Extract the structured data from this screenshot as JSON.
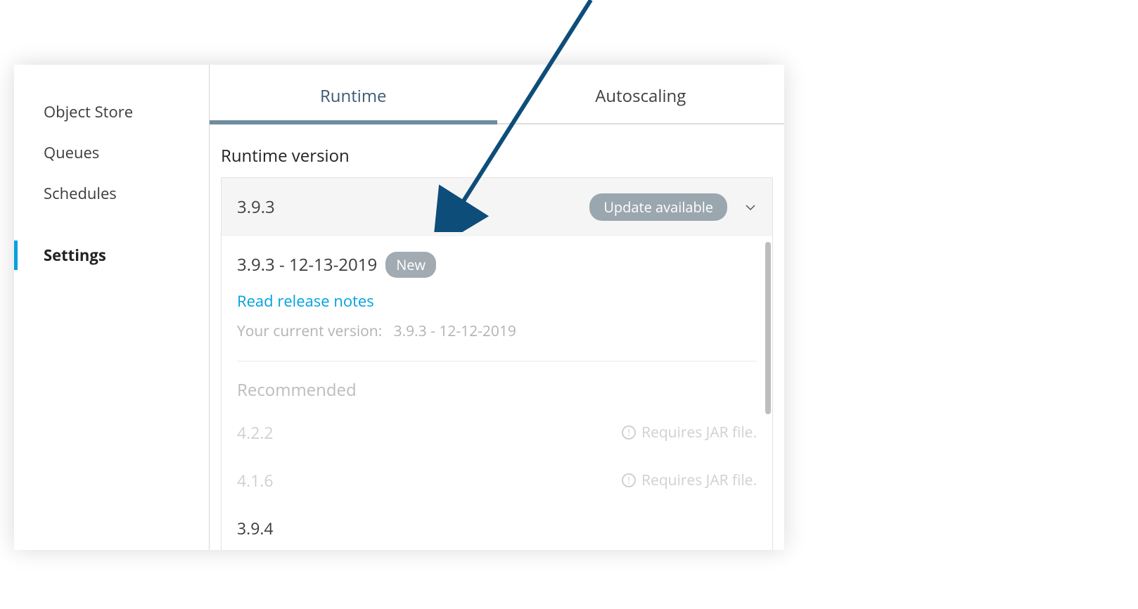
{
  "sidebar": {
    "items": [
      {
        "label": "Object Store",
        "active": false
      },
      {
        "label": "Queues",
        "active": false
      },
      {
        "label": "Schedules",
        "active": false
      },
      {
        "label": "Settings",
        "active": true
      }
    ]
  },
  "tabs": {
    "runtime": "Runtime",
    "autoscaling": "Autoscaling",
    "active": "runtime"
  },
  "runtime": {
    "section_title": "Runtime version",
    "selected": "3.9.3",
    "update_badge": "Update available",
    "highlight": {
      "version_line": "3.9.3 - 12-13-2019",
      "new_badge": "New",
      "release_notes_link": "Read release notes",
      "current_label": "Your current version:",
      "current_value": "3.9.3 - 12-12-2019"
    },
    "recommended_title": "Recommended",
    "jar_note": "Requires JAR file.",
    "options": [
      {
        "label": "4.2.2",
        "requires_jar": true,
        "enabled": false
      },
      {
        "label": "4.1.6",
        "requires_jar": true,
        "enabled": false
      },
      {
        "label": "3.9.4",
        "requires_jar": false,
        "enabled": true
      }
    ]
  }
}
